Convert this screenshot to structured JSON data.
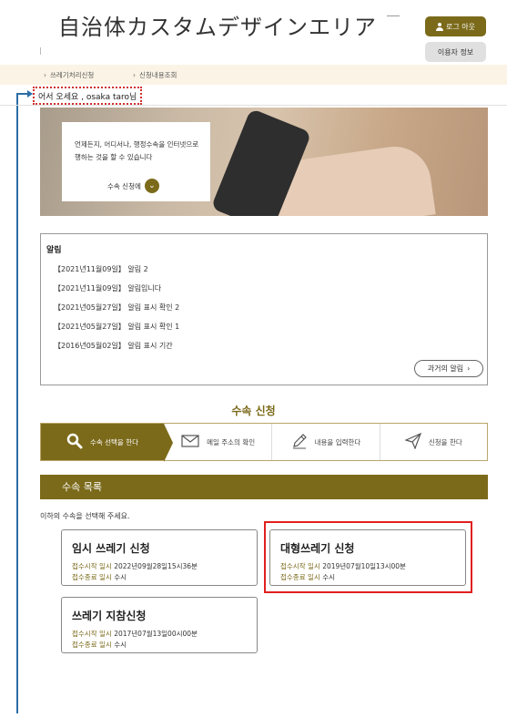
{
  "site_title": "自治体カスタムデザインエリア",
  "header": {
    "logout_label": "로그 아웃",
    "userinfo_label": "이용자 정보"
  },
  "breadcrumbs": [
    {
      "label": "쓰레기처리신청"
    },
    {
      "label": "신청내용조회"
    }
  ],
  "welcome": "어서 오세요 , osaka  taro님",
  "hero": {
    "text": "언제든지, 어디서나, 행정수속을 인터넷으로 행하는 것을 할 수 있습니다",
    "link_label": "수속 신청에"
  },
  "notice": {
    "title": "알림",
    "items": [
      {
        "text": "【2021년11월09일】 알림 2"
      },
      {
        "text": "【2021년11월09일】 알림입니다"
      },
      {
        "text": "【2021년05월27일】 알림 표시 확인 2"
      },
      {
        "text": "【2021년05월27일】 알림 표시 확인 1"
      },
      {
        "text": "【2016년05월02일】 알림 표시 기간"
      }
    ],
    "past_button": "과거의 알림"
  },
  "procedure": {
    "title": "수속 신청",
    "steps": [
      {
        "label": "수속 선택을 한다",
        "icon": "search-icon"
      },
      {
        "label": "메일 주소의 확인",
        "icon": "mail-icon"
      },
      {
        "label": "내용을 입력한다",
        "icon": "pencil-icon"
      },
      {
        "label": "신청을 한다",
        "icon": "send-icon"
      }
    ]
  },
  "list": {
    "header": "수속 목록",
    "instruction": "이하의 수속을 선택해 주세요.",
    "start_label": "접수시작 일시",
    "end_label": "접수종료 일시",
    "items": [
      {
        "name": "임시 쓰레기 신청",
        "start": "2022년09월28일15시36분",
        "end": "수시"
      },
      {
        "name": "대형쓰레기 신청",
        "start": "2019년07월10일13시00분",
        "end": "수시"
      },
      {
        "name": "쓰레기 지참신청",
        "start": "2017년07월13일00시00분",
        "end": "수시"
      }
    ]
  },
  "colors": {
    "accent": "#7b6a1a",
    "highlight": "#e02020",
    "arrow": "#2d6ea6",
    "breadcrumb_bg": "#fbf4e6"
  }
}
